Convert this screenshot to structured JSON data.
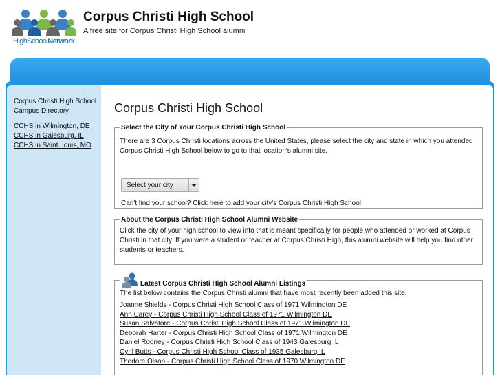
{
  "header": {
    "logo_part1": "HighSchool",
    "logo_part2": "Network",
    "title": "Corpus Christi High School",
    "subtitle": "A free site for Corpus Christi High School alumni"
  },
  "sidebar": {
    "heading": "Corpus Christi High School Campus Directory",
    "links": [
      "CCHS in Wilmington, DE",
      "CCHS in Galesburg, IL",
      "CCHS in Saint Louis, MO"
    ]
  },
  "main": {
    "title": "Corpus Christi High School",
    "select_city": {
      "legend": "Select the City of Your Corpus Christi High School",
      "description": "There are 3 Corpus Christi locations across the United States, please select the city and state in which you attended Corpus Christi High School below to go to that location's alumni site.",
      "dropdown_value": "Select your city",
      "cant_find_link": "Can't find your school? Click here to add your city's Corpus Christi High School"
    },
    "about": {
      "legend": "About the Corpus Christi High School Alumni Website",
      "text": "Click the city of your high school to view info that is meant specifically for people who attended or worked at Corpus Christi in that city. If you were a student or teacher at Corpus Christi High, this alumni website will help you find other students or teachers."
    },
    "latest": {
      "legend": "Latest Corpus Christi High School Alumni Listings",
      "intro": "The list below contains the Corpus Christi alumni that have most recently been added this site.",
      "listings": [
        "Joanne Shields - Corpus Christi High School Class of 1971 Wilmington DE",
        "Ann Carey - Corpus Christi High School Class of 1971 Wilmington DE",
        "Susan Salvatore - Corpus Christi High School Class of 1971 Wilmington DE",
        "Deborah Harter - Corpus Christi High School Class of 1971 Wilmington DE",
        "Daniel Rooney - Corpus Christi High School Class of 1943 Galesburg IL",
        "Cyril Butts - Corpus Christi High School Class of 1935 Galesburg IL",
        "Thedore Olson - Corpus Christi High School Class of 1970 Wilmington DE"
      ]
    }
  },
  "colors": {
    "brand_blue": "#1e94e4",
    "sidebar_bg": "#cfe6f6",
    "logo_blue": "#2f6fb0"
  },
  "icons": [
    "people-logo-icon",
    "people-icon",
    "chevron-down-icon"
  ]
}
